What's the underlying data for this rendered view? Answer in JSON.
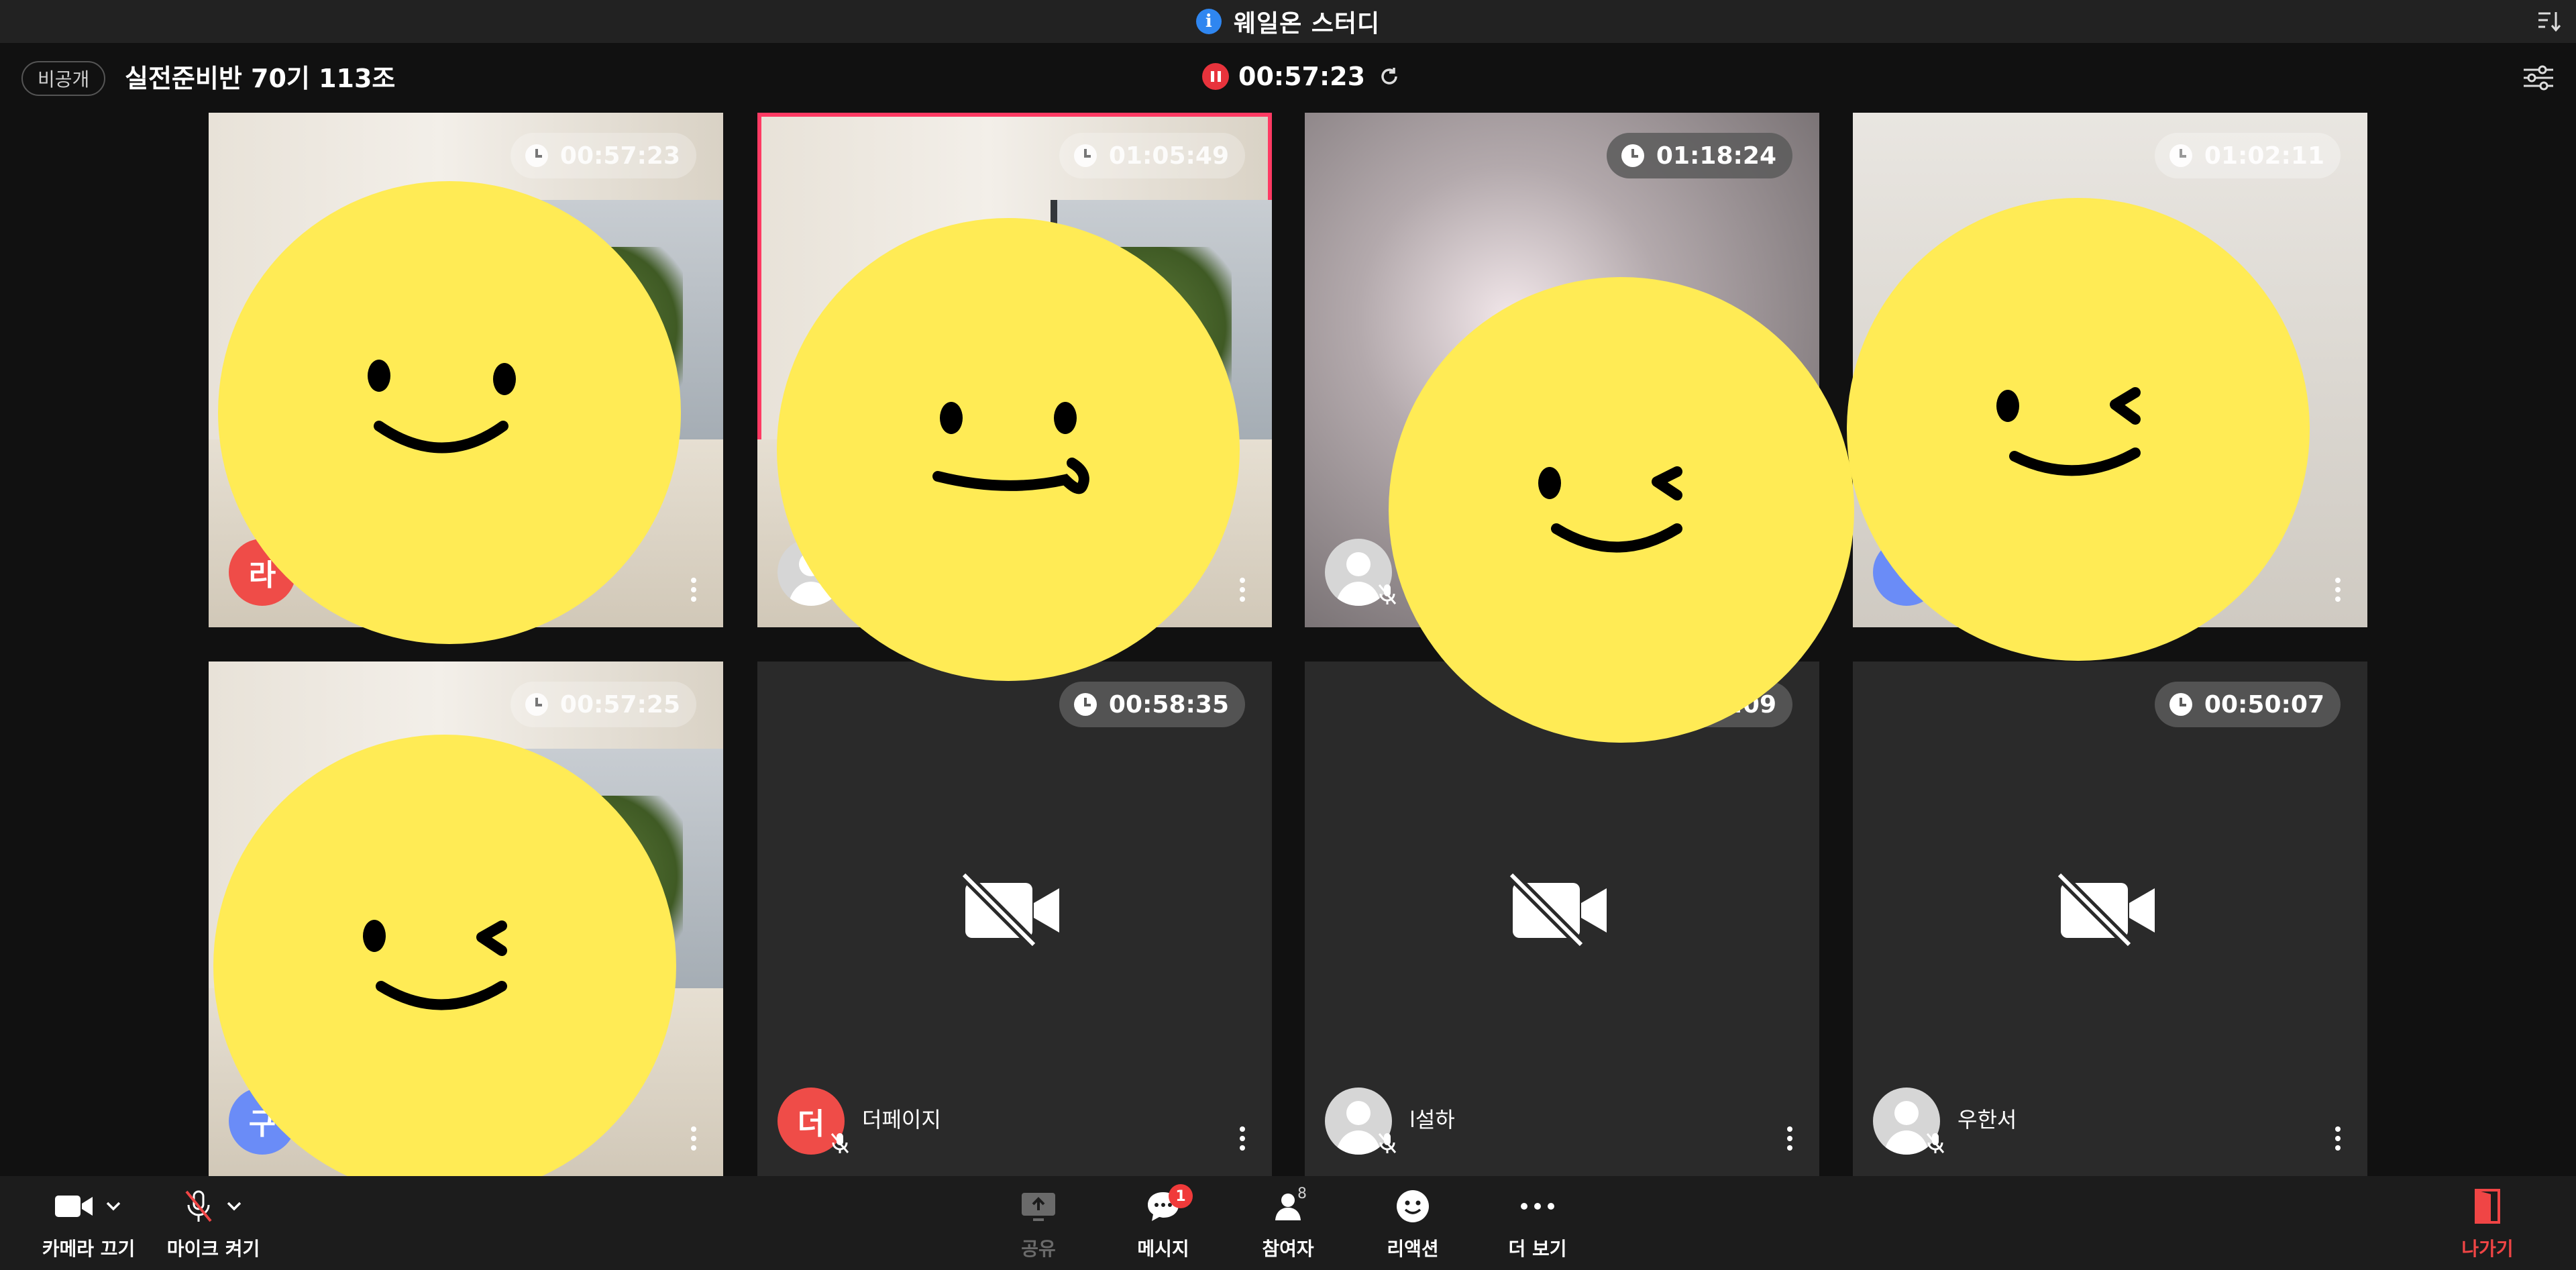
{
  "window": {
    "title": "웨일온 스터디"
  },
  "header": {
    "privacy_badge": "비공개",
    "room_name": "실전준비반 70기 113조",
    "recording_time": "00:57:23"
  },
  "participants": [
    {
      "timer": "00:57:23",
      "avatar_letter": "라",
      "name": "",
      "video": true
    },
    {
      "timer": "01:05:49",
      "avatar_letter": "",
      "name": "",
      "video": true,
      "active_speaker": true
    },
    {
      "timer": "01:18:24",
      "avatar_letter": "",
      "name": "",
      "video": true
    },
    {
      "timer": "01:02:11",
      "avatar_letter": "",
      "name": "",
      "video": true
    },
    {
      "timer": "00:57:25",
      "avatar_letter": "구",
      "name": "",
      "video": true
    },
    {
      "timer": "00:58:35",
      "avatar_letter": "더",
      "name": "더페이지",
      "video": false
    },
    {
      "timer": "00:50:09",
      "avatar_letter": "",
      "name": "l설하",
      "video": false
    },
    {
      "timer": "00:50:07",
      "avatar_letter": "",
      "name": "우한서",
      "video": false
    }
  ],
  "toolbar": {
    "camera_label": "카메라 끄기",
    "mic_label": "마이크 켜기",
    "share_label": "공유",
    "message_label": "메시지",
    "message_badge": "1",
    "participants_label": "참여자",
    "participants_count": "8",
    "reaction_label": "리액션",
    "more_label": "더 보기",
    "leave_label": "나가기"
  },
  "colors": {
    "accent_red": "#e8333c",
    "active_border": "#ff3a63",
    "smiley_yellow": "#ffeb55",
    "info_blue": "#2f86f0"
  }
}
